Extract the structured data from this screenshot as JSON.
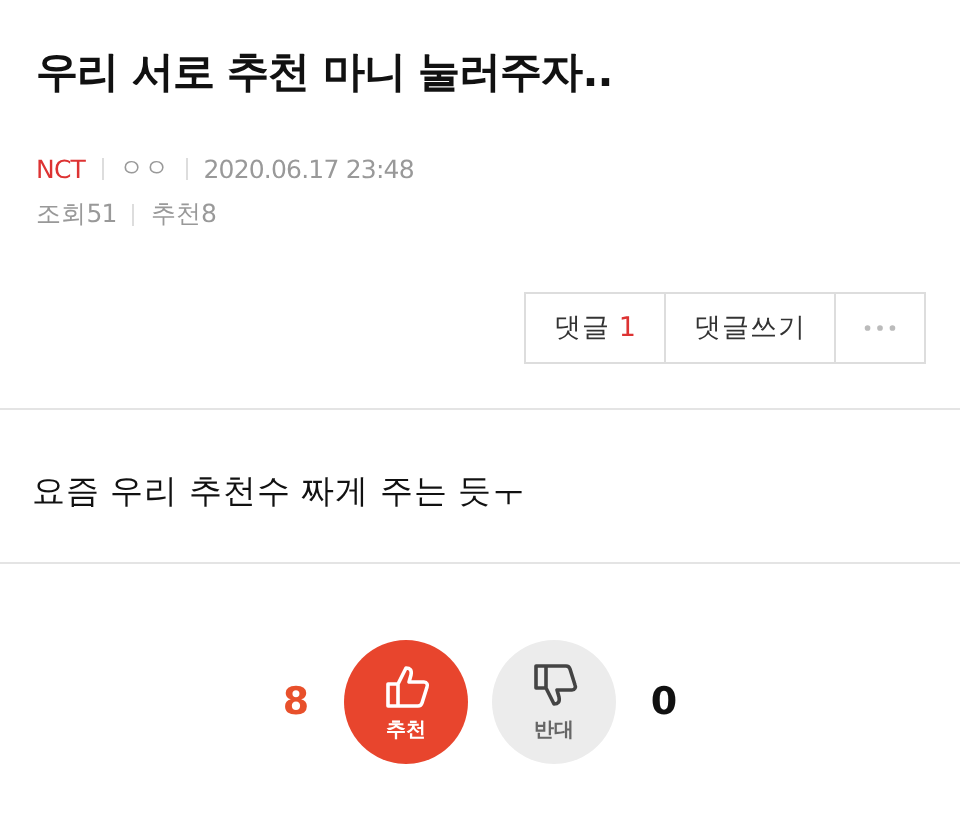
{
  "title": "우리 서로 추천 마니 눌러주자..",
  "meta": {
    "board": "NCT",
    "author": "ㅇㅇ",
    "datetime": "2020.06.17 23:48",
    "views": "조회51",
    "recommends": "추천8"
  },
  "actions": {
    "comment_label": "댓글",
    "comment_count": "1",
    "write_label": "댓글쓰기"
  },
  "body": "요즘 우리 추천수 짜게 주는 듯ㅜ",
  "votes": [
    {
      "kind": "up",
      "count": "8",
      "label": "추천"
    },
    {
      "kind": "down",
      "count": "0",
      "label": "반대"
    }
  ]
}
